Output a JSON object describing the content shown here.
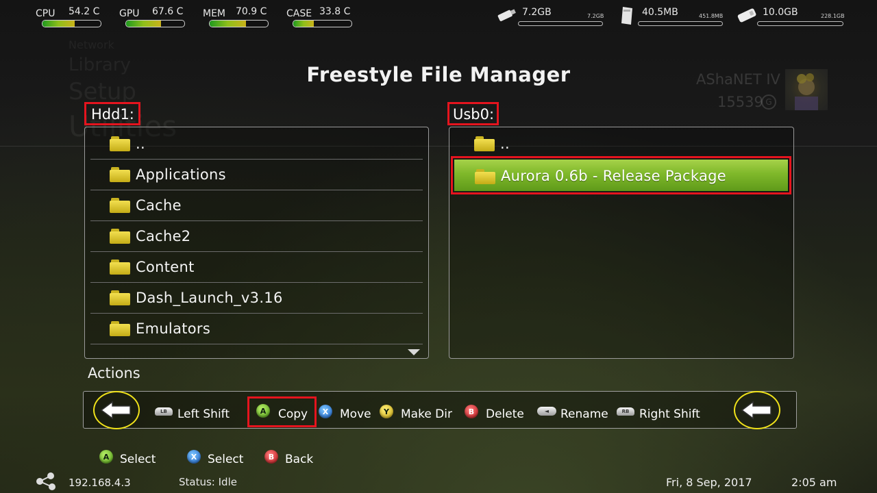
{
  "stats": [
    {
      "label": "CPU",
      "value": "54.2 C",
      "fill": 0.55
    },
    {
      "label": "GPU",
      "value": "67.6 C",
      "fill": 0.6
    },
    {
      "label": "MEM",
      "value": "70.9 C",
      "fill": 0.62
    },
    {
      "label": "CASE",
      "value": "33.8 C",
      "fill": 0.35
    }
  ],
  "drives": [
    {
      "free": "7.2GB",
      "total": "7.2GB",
      "icon": "usb-drive-icon",
      "used": 0.0
    },
    {
      "free": "40.5MB",
      "total": "451.8MB",
      "icon": "memory-unit-icon",
      "used": 0.0
    },
    {
      "free": "10.0GB",
      "total": "228.1GB",
      "icon": "hard-drive-icon",
      "used": 0.0
    }
  ],
  "menu": [
    "Network",
    "Library",
    "Setup",
    "Utilities"
  ],
  "title": "Freestyle File Manager",
  "profile": {
    "gamertag": "AShaNET IV",
    "gamerscore": "15539",
    "gamerscore_icon": "G"
  },
  "left_pane": {
    "title": "Hdd1:",
    "items": [
      "..",
      "Applications",
      "Cache",
      "Cache2",
      "Content",
      "Dash_Launch_v3.16",
      "Emulators"
    ]
  },
  "right_pane": {
    "title": "Usb0:",
    "items": [
      "..",
      "Aurora 0.6b - Release Package"
    ],
    "selected_index": 1
  },
  "actions": {
    "heading": "Actions",
    "items": [
      {
        "button": "LB",
        "label": "Left Shift",
        "icon": "lb-bumper-icon"
      },
      {
        "button": "A",
        "label": "Copy",
        "icon": "a-button-icon"
      },
      {
        "button": "X",
        "label": "Move",
        "icon": "x-button-icon"
      },
      {
        "button": "Y",
        "label": "Make Dir",
        "icon": "y-button-icon"
      },
      {
        "button": "B",
        "label": "Delete",
        "icon": "b-button-icon"
      },
      {
        "button": "◄",
        "label": "Rename",
        "icon": "back-button-icon"
      },
      {
        "button": "RB",
        "label": "Right Shift",
        "icon": "rb-bumper-icon"
      }
    ]
  },
  "hints": [
    {
      "button": "A",
      "label": "Select"
    },
    {
      "button": "X",
      "label": "Select"
    },
    {
      "button": "B",
      "label": "Back"
    }
  ],
  "footer": {
    "ip": "192.168.4.3",
    "status": "Status: Idle",
    "date": "Fri, 8 Sep, 2017",
    "time": "2:05 am"
  },
  "colors": {
    "highlight_red": "#e5141e",
    "selection_green": "#7fb82a",
    "annotation_yellow": "#f0e21a"
  }
}
